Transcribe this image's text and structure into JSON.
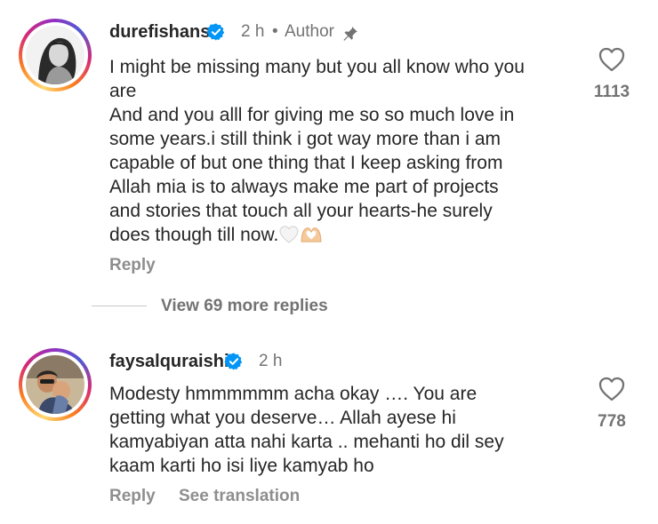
{
  "comments": [
    {
      "username": "durefishans",
      "time": "2 h",
      "separator": "•",
      "role": "Author",
      "text_lines": [
        "I might be missing many but you all know who you",
        "are",
        "And and you alll for giving me so so much love in",
        "some years.i still think i got way more than i am",
        "capable of but one thing that I keep asking from",
        "Allah mia is to always make me part of projects",
        "and stories that touch all your hearts-he surely",
        "does though till now."
      ],
      "emojis": [
        "white-heart-icon",
        "heart-hands-icon"
      ],
      "likes": "1113",
      "reply_label": "Reply",
      "view_replies": "View 69 more replies"
    },
    {
      "username": "faysalquraishi",
      "time": "2 h",
      "text_lines": [
        "Modesty hmmmmmm acha okay …. You are",
        "getting what you deserve… Allah ayese hi",
        "kamyabiyan atta nahi karta .. mehanti ho dil sey",
        "kaam karti ho isi liye kamyab ho"
      ],
      "likes": "778",
      "reply_label": "Reply",
      "translation_label": "See translation"
    }
  ],
  "colors": {
    "verified_blue": "#0095f6",
    "secondary_text": "#737373",
    "primary_text": "#262626"
  }
}
